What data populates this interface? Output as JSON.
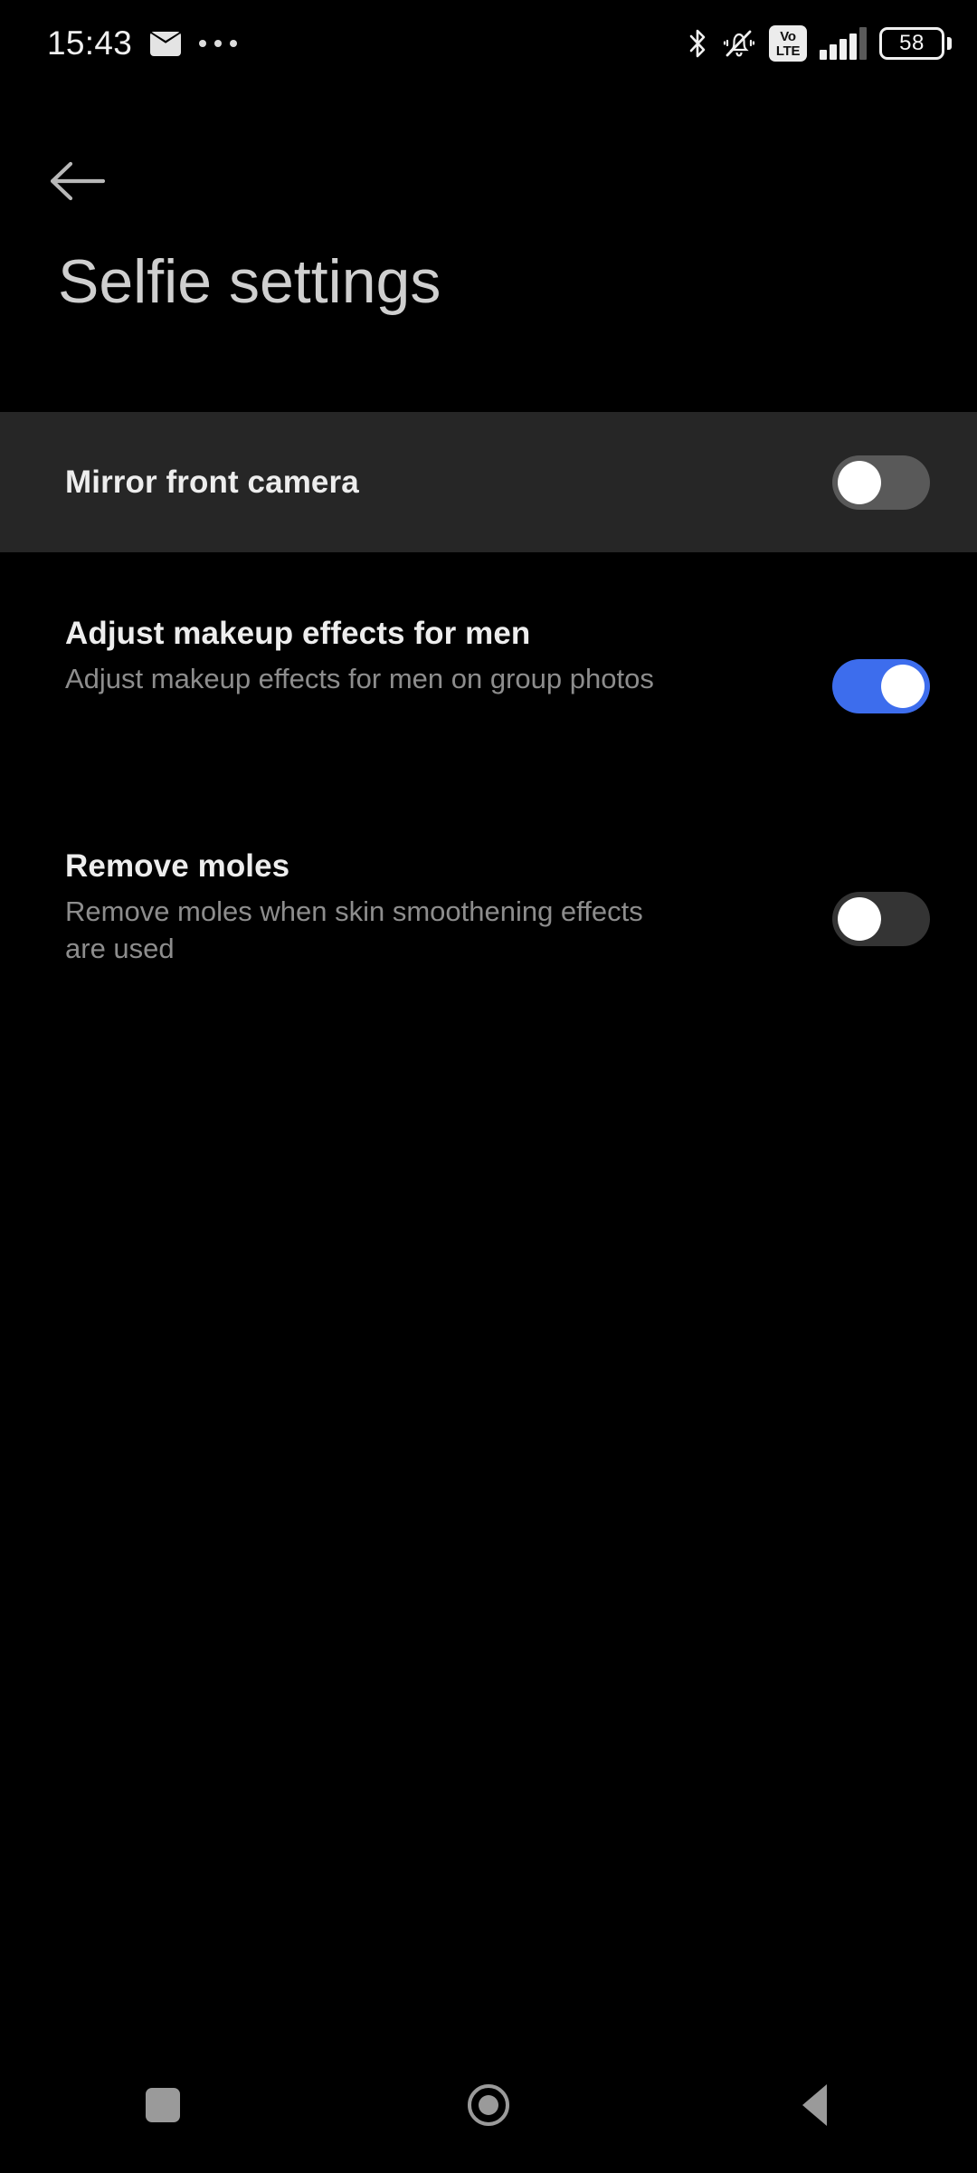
{
  "statusbar": {
    "time": "15:43",
    "mail_icon": "mail-icon",
    "overflow_icon": "more-notifications-icon",
    "bluetooth_icon": "bluetooth-icon",
    "silent_icon": "bell-muted-icon",
    "volte_line1": "Vo",
    "volte_line2": "LTE",
    "signal_icon": "signal-bars-icon",
    "battery_level": "58"
  },
  "header": {
    "back_icon": "back-arrow-icon",
    "title": "Selfie settings"
  },
  "settings": [
    {
      "title": "Mirror front camera",
      "subtitle": "",
      "toggle_state": "off",
      "highlighted": true
    },
    {
      "title": "Adjust makeup effects for men",
      "subtitle": "Adjust makeup effects for men on group photos",
      "toggle_state": "on",
      "highlighted": false
    },
    {
      "title": "Remove moles",
      "subtitle": "Remove moles when skin smoothening effects are used",
      "toggle_state": "off",
      "highlighted": false
    }
  ],
  "navbar": {
    "recents_icon": "recents-square-icon",
    "home_icon": "home-circle-icon",
    "back_icon": "back-triangle-icon"
  },
  "colors": {
    "background": "#000000",
    "highlight_row": "#262626",
    "accent_blue": "#3d6ded",
    "title_text": "#cfcfcf",
    "row_title_text": "#ededed",
    "row_sub_text": "#8d8d8d",
    "nav_icon": "#9a9a9a"
  }
}
